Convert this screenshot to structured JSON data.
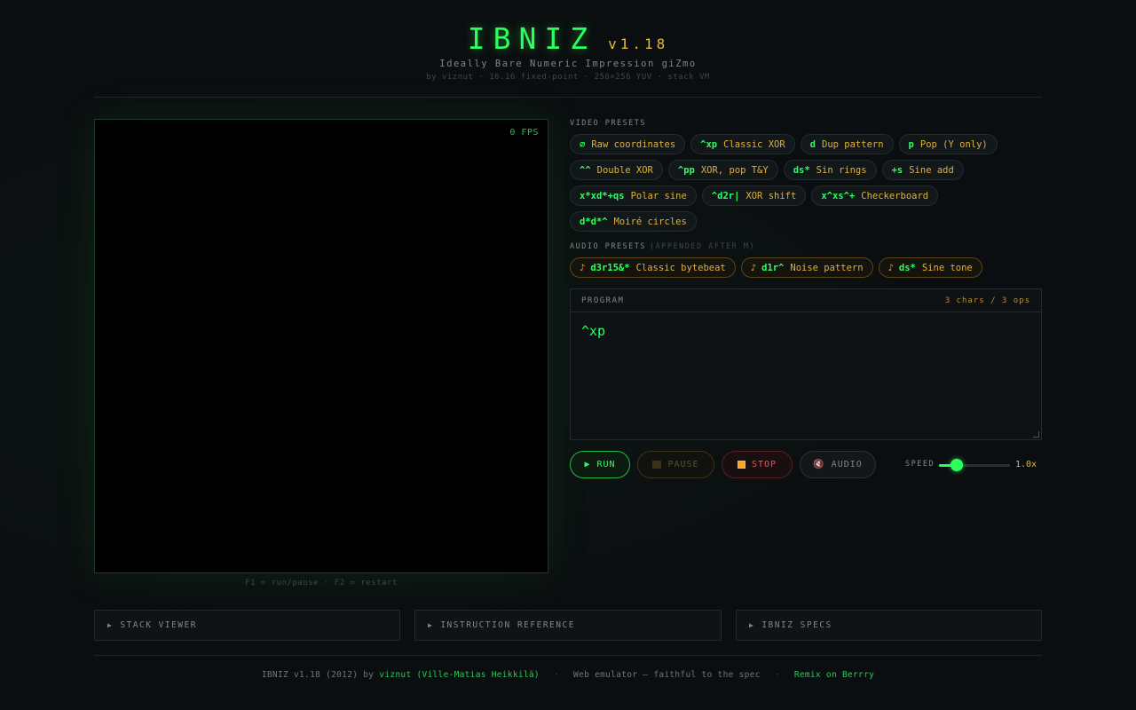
{
  "header": {
    "title": "IBNIZ",
    "version": "v1.18",
    "subtitle": "Ideally Bare Numeric Impression giZmo",
    "byline": "by viznut · 16.16 fixed-point · 256×256 YUV · stack VM"
  },
  "screen": {
    "fps": "0 FPS",
    "hint": "F1 = run/pause · F2 = restart"
  },
  "video_presets": {
    "label": "VIDEO PRESETS",
    "items": [
      {
        "code": "∅",
        "label": "Raw coordinates"
      },
      {
        "code": "^xp",
        "label": "Classic XOR"
      },
      {
        "code": "d",
        "label": "Dup pattern"
      },
      {
        "code": "p",
        "label": "Pop (Y only)"
      },
      {
        "code": "^^",
        "label": "Double XOR"
      },
      {
        "code": "^pp",
        "label": "XOR, pop T&Y"
      },
      {
        "code": "ds*",
        "label": "Sin rings"
      },
      {
        "code": "+s",
        "label": "Sine add"
      },
      {
        "code": "x*xd*+qs",
        "label": "Polar sine"
      },
      {
        "code": "^d2r|",
        "label": "XOR shift"
      },
      {
        "code": "x^xs^+",
        "label": "Checkerboard"
      },
      {
        "code": "d*d*^",
        "label": "Moiré circles"
      }
    ]
  },
  "audio_presets": {
    "label": "AUDIO PRESETS",
    "sublabel": "(APPENDED AFTER M)",
    "note_symbol": "♪",
    "items": [
      {
        "code": "d3r15&*",
        "label": "Classic bytebeat"
      },
      {
        "code": "d1r^",
        "label": "Noise pattern"
      },
      {
        "code": "ds*",
        "label": "Sine tone"
      }
    ]
  },
  "program": {
    "label": "PROGRAM",
    "count": "3 chars / 3 ops",
    "code": "^xp"
  },
  "controls": {
    "run_icon": "▶",
    "run": "RUN",
    "pause": "PAUSE",
    "stop": "STOP",
    "audio_icon": "🔇",
    "audio": "AUDIO",
    "speed_label": "SPEED",
    "speed_value": "1.0x",
    "speed_fraction": 0.25
  },
  "panels": [
    {
      "label": "STACK VIEWER"
    },
    {
      "label": "INSTRUCTION REFERENCE"
    },
    {
      "label": "IBNIZ SPECS"
    }
  ],
  "panel_arrow": "▶",
  "footer": {
    "prefix": "IBNIZ v1.18 (2012) by",
    "author": "viznut (Ville-Matias Heikkilä)",
    "separator": "·",
    "middle": "Web emulator — faithful to the spec",
    "remix": "Remix on Berrry"
  },
  "colors": {
    "accent_green": "#2bff5e",
    "accent_amber": "#e6b93a",
    "stop_red": "#ff4a4a",
    "background": "#0b0e10"
  }
}
